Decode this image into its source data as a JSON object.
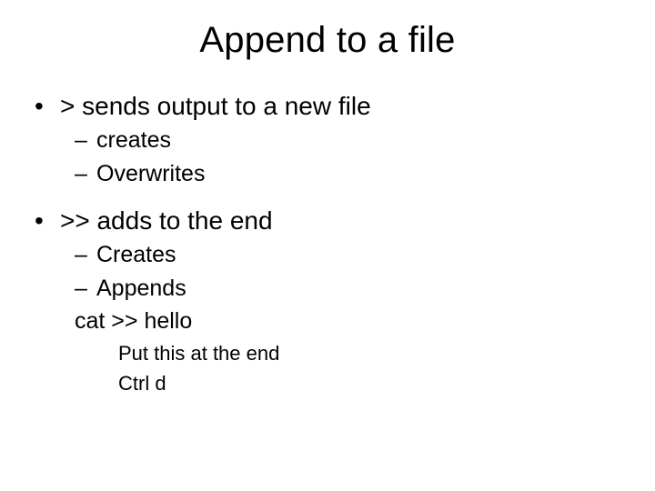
{
  "title": "Append to a file",
  "bullets": [
    {
      "text": "> sends output to a new file",
      "sub": [
        {
          "text": "creates",
          "dash": true
        },
        {
          "text": "Overwrites",
          "dash": true
        }
      ]
    },
    {
      "text": ">> adds to the end",
      "sub": [
        {
          "text": "Creates",
          "dash": true
        },
        {
          "text": "Appends",
          "dash": true
        },
        {
          "text": "cat >> hello",
          "dash": false
        }
      ],
      "subsub": [
        "Put this at the end",
        "Ctrl d"
      ]
    }
  ]
}
